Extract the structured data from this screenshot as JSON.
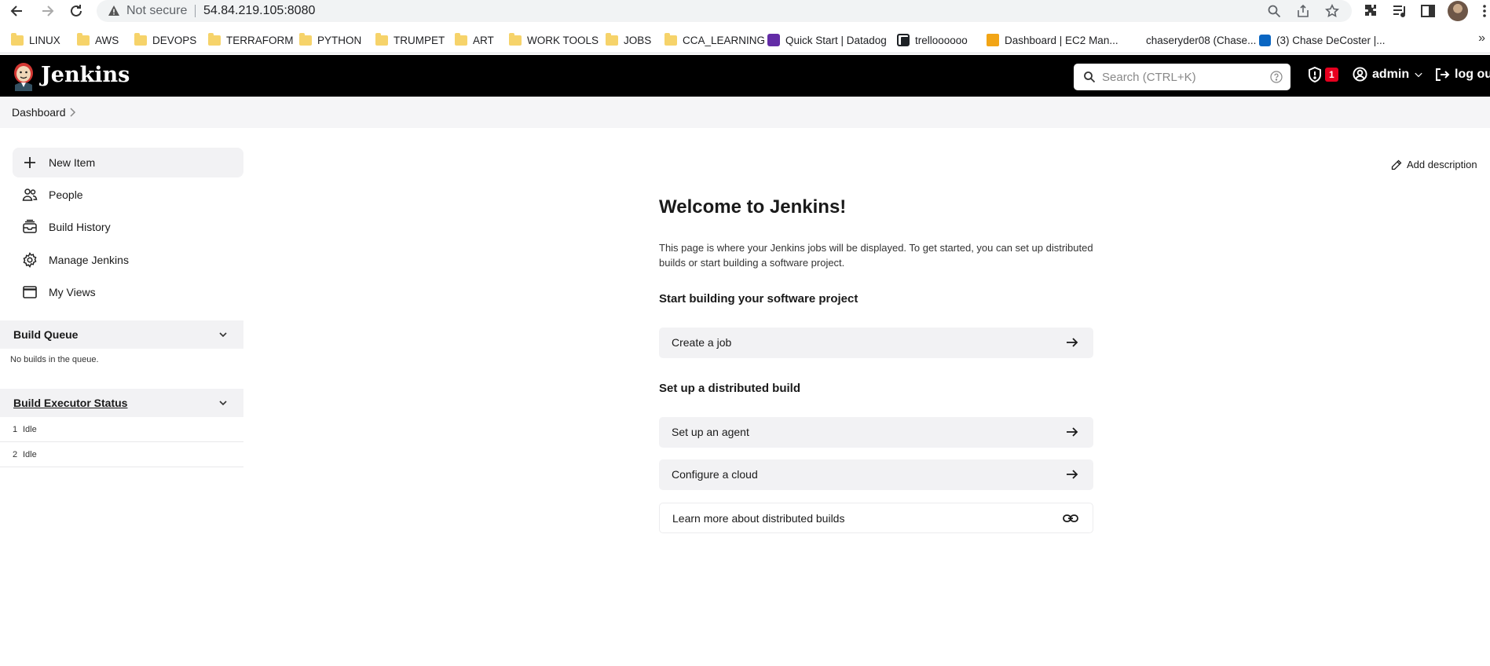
{
  "browser": {
    "security_label": "Not secure",
    "url": "54.84.219.105:8080",
    "bookmarks": [
      {
        "label": "LINUX",
        "icon": "folder-icon"
      },
      {
        "label": "AWS",
        "icon": "folder-icon"
      },
      {
        "label": "DEVOPS",
        "icon": "folder-icon"
      },
      {
        "label": "TERRAFORM",
        "icon": "folder-icon"
      },
      {
        "label": "PYTHON",
        "icon": "folder-icon"
      },
      {
        "label": "TRUMPET",
        "icon": "folder-icon"
      },
      {
        "label": "ART",
        "icon": "folder-icon"
      },
      {
        "label": "WORK TOOLS",
        "icon": "folder-icon"
      },
      {
        "label": "JOBS",
        "icon": "folder-icon"
      },
      {
        "label": "CCA_LEARNING",
        "icon": "folder-icon"
      },
      {
        "label": "Quick Start | Datadog",
        "icon": "datadog-icon",
        "color": "#632ca6"
      },
      {
        "label": "trelloooooo",
        "icon": "trello-icon",
        "color": "#1d2125"
      },
      {
        "label": "Dashboard | EC2 Man...",
        "icon": "aws-cube-icon",
        "color": "#f2a516"
      },
      {
        "label": "chaseryder08 (Chase...",
        "icon": "none"
      },
      {
        "label": "(3) Chase DeCoster |...",
        "icon": "linkedin-icon",
        "color": "#0a66c2"
      }
    ],
    "more_bookmarks": "»"
  },
  "header": {
    "brand": "Jenkins",
    "search_placeholder": "Search (CTRL+K)",
    "security_count": "1",
    "user": "admin",
    "logout": "log out"
  },
  "breadcrumb": {
    "items": [
      "Dashboard"
    ]
  },
  "sidebar": {
    "tasks": [
      {
        "label": "New Item",
        "icon": "plus-icon"
      },
      {
        "label": "People",
        "icon": "people-icon"
      },
      {
        "label": "Build History",
        "icon": "build-history-icon"
      },
      {
        "label": "Manage Jenkins",
        "icon": "gear-icon"
      },
      {
        "label": "My Views",
        "icon": "window-icon"
      }
    ],
    "build_queue": {
      "title": "Build Queue",
      "empty": "No builds in the queue."
    },
    "executors": {
      "title": "Build Executor Status",
      "rows": [
        {
          "num": "1",
          "status": "Idle"
        },
        {
          "num": "2",
          "status": "Idle"
        }
      ]
    }
  },
  "main": {
    "add_description": "Add description",
    "title": "Welcome to Jenkins!",
    "intro": "This page is where your Jenkins jobs will be displayed. To get started, you can set up distributed builds or start building a software project.",
    "section_build": "Start building your software project",
    "create_job": "Create a job",
    "section_distributed": "Set up a distributed build",
    "setup_agent": "Set up an agent",
    "configure_cloud": "Configure a cloud",
    "learn_more": "Learn more about distributed builds"
  }
}
